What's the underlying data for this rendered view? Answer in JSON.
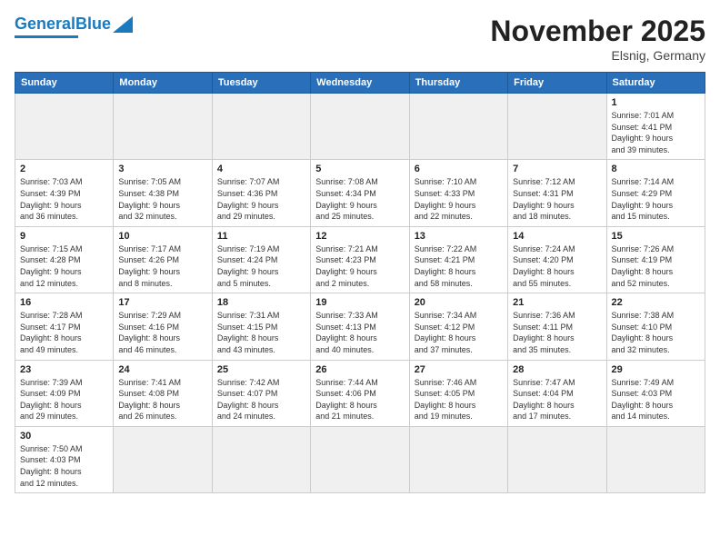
{
  "header": {
    "logo_general": "General",
    "logo_blue": "Blue",
    "title": "November 2025",
    "location": "Elsnig, Germany"
  },
  "weekdays": [
    "Sunday",
    "Monday",
    "Tuesday",
    "Wednesday",
    "Thursday",
    "Friday",
    "Saturday"
  ],
  "weeks": [
    [
      {
        "day": "",
        "info": ""
      },
      {
        "day": "",
        "info": ""
      },
      {
        "day": "",
        "info": ""
      },
      {
        "day": "",
        "info": ""
      },
      {
        "day": "",
        "info": ""
      },
      {
        "day": "",
        "info": ""
      },
      {
        "day": "1",
        "info": "Sunrise: 7:01 AM\nSunset: 4:41 PM\nDaylight: 9 hours\nand 39 minutes."
      }
    ],
    [
      {
        "day": "2",
        "info": "Sunrise: 7:03 AM\nSunset: 4:39 PM\nDaylight: 9 hours\nand 36 minutes."
      },
      {
        "day": "3",
        "info": "Sunrise: 7:05 AM\nSunset: 4:38 PM\nDaylight: 9 hours\nand 32 minutes."
      },
      {
        "day": "4",
        "info": "Sunrise: 7:07 AM\nSunset: 4:36 PM\nDaylight: 9 hours\nand 29 minutes."
      },
      {
        "day": "5",
        "info": "Sunrise: 7:08 AM\nSunset: 4:34 PM\nDaylight: 9 hours\nand 25 minutes."
      },
      {
        "day": "6",
        "info": "Sunrise: 7:10 AM\nSunset: 4:33 PM\nDaylight: 9 hours\nand 22 minutes."
      },
      {
        "day": "7",
        "info": "Sunrise: 7:12 AM\nSunset: 4:31 PM\nDaylight: 9 hours\nand 18 minutes."
      },
      {
        "day": "8",
        "info": "Sunrise: 7:14 AM\nSunset: 4:29 PM\nDaylight: 9 hours\nand 15 minutes."
      }
    ],
    [
      {
        "day": "9",
        "info": "Sunrise: 7:15 AM\nSunset: 4:28 PM\nDaylight: 9 hours\nand 12 minutes."
      },
      {
        "day": "10",
        "info": "Sunrise: 7:17 AM\nSunset: 4:26 PM\nDaylight: 9 hours\nand 8 minutes."
      },
      {
        "day": "11",
        "info": "Sunrise: 7:19 AM\nSunset: 4:24 PM\nDaylight: 9 hours\nand 5 minutes."
      },
      {
        "day": "12",
        "info": "Sunrise: 7:21 AM\nSunset: 4:23 PM\nDaylight: 9 hours\nand 2 minutes."
      },
      {
        "day": "13",
        "info": "Sunrise: 7:22 AM\nSunset: 4:21 PM\nDaylight: 8 hours\nand 58 minutes."
      },
      {
        "day": "14",
        "info": "Sunrise: 7:24 AM\nSunset: 4:20 PM\nDaylight: 8 hours\nand 55 minutes."
      },
      {
        "day": "15",
        "info": "Sunrise: 7:26 AM\nSunset: 4:19 PM\nDaylight: 8 hours\nand 52 minutes."
      }
    ],
    [
      {
        "day": "16",
        "info": "Sunrise: 7:28 AM\nSunset: 4:17 PM\nDaylight: 8 hours\nand 49 minutes."
      },
      {
        "day": "17",
        "info": "Sunrise: 7:29 AM\nSunset: 4:16 PM\nDaylight: 8 hours\nand 46 minutes."
      },
      {
        "day": "18",
        "info": "Sunrise: 7:31 AM\nSunset: 4:15 PM\nDaylight: 8 hours\nand 43 minutes."
      },
      {
        "day": "19",
        "info": "Sunrise: 7:33 AM\nSunset: 4:13 PM\nDaylight: 8 hours\nand 40 minutes."
      },
      {
        "day": "20",
        "info": "Sunrise: 7:34 AM\nSunset: 4:12 PM\nDaylight: 8 hours\nand 37 minutes."
      },
      {
        "day": "21",
        "info": "Sunrise: 7:36 AM\nSunset: 4:11 PM\nDaylight: 8 hours\nand 35 minutes."
      },
      {
        "day": "22",
        "info": "Sunrise: 7:38 AM\nSunset: 4:10 PM\nDaylight: 8 hours\nand 32 minutes."
      }
    ],
    [
      {
        "day": "23",
        "info": "Sunrise: 7:39 AM\nSunset: 4:09 PM\nDaylight: 8 hours\nand 29 minutes."
      },
      {
        "day": "24",
        "info": "Sunrise: 7:41 AM\nSunset: 4:08 PM\nDaylight: 8 hours\nand 26 minutes."
      },
      {
        "day": "25",
        "info": "Sunrise: 7:42 AM\nSunset: 4:07 PM\nDaylight: 8 hours\nand 24 minutes."
      },
      {
        "day": "26",
        "info": "Sunrise: 7:44 AM\nSunset: 4:06 PM\nDaylight: 8 hours\nand 21 minutes."
      },
      {
        "day": "27",
        "info": "Sunrise: 7:46 AM\nSunset: 4:05 PM\nDaylight: 8 hours\nand 19 minutes."
      },
      {
        "day": "28",
        "info": "Sunrise: 7:47 AM\nSunset: 4:04 PM\nDaylight: 8 hours\nand 17 minutes."
      },
      {
        "day": "29",
        "info": "Sunrise: 7:49 AM\nSunset: 4:03 PM\nDaylight: 8 hours\nand 14 minutes."
      }
    ],
    [
      {
        "day": "30",
        "info": "Sunrise: 7:50 AM\nSunset: 4:03 PM\nDaylight: 8 hours\nand 12 minutes."
      },
      {
        "day": "",
        "info": ""
      },
      {
        "day": "",
        "info": ""
      },
      {
        "day": "",
        "info": ""
      },
      {
        "day": "",
        "info": ""
      },
      {
        "day": "",
        "info": ""
      },
      {
        "day": "",
        "info": ""
      }
    ]
  ]
}
